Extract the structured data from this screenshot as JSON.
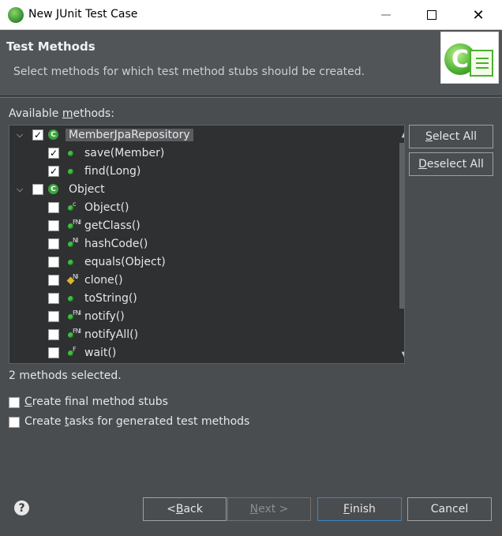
{
  "window": {
    "title": "New JUnit Test Case"
  },
  "header": {
    "title": "Test Methods",
    "description": "Select methods for which test method stubs should be created."
  },
  "available_label_pre": "Available ",
  "available_label_u": "m",
  "available_label_post": "ethods:",
  "tree": {
    "nodes": [
      {
        "label": "MemberJpaRepository",
        "level": 0,
        "checked": true,
        "icon": "class-icon",
        "expanded": true,
        "selected": true
      },
      {
        "label": "save(Member)",
        "level": 1,
        "checked": true,
        "icon": "public-method-icon"
      },
      {
        "label": "find(Long)",
        "level": 1,
        "checked": true,
        "icon": "public-method-icon"
      },
      {
        "label": "Object",
        "level": 0,
        "checked": false,
        "icon": "class-icon",
        "expanded": true
      },
      {
        "label": "Object()",
        "level": 1,
        "checked": false,
        "icon": "constructor-icon"
      },
      {
        "label": "getClass()",
        "level": 1,
        "checked": false,
        "icon": "final-native-method-icon"
      },
      {
        "label": "hashCode()",
        "level": 1,
        "checked": false,
        "icon": "native-method-icon"
      },
      {
        "label": "equals(Object)",
        "level": 1,
        "checked": false,
        "icon": "public-method-icon"
      },
      {
        "label": "clone()",
        "level": 1,
        "checked": false,
        "icon": "protected-method-icon"
      },
      {
        "label": "toString()",
        "level": 1,
        "checked": false,
        "icon": "public-method-icon"
      },
      {
        "label": "notify()",
        "level": 1,
        "checked": false,
        "icon": "final-native-method-icon"
      },
      {
        "label": "notifyAll()",
        "level": 1,
        "checked": false,
        "icon": "final-native-method-icon"
      },
      {
        "label": "wait()",
        "level": 1,
        "checked": false,
        "icon": "final-method-icon"
      }
    ]
  },
  "buttons": {
    "select_all_u": "S",
    "select_all_rest": "elect All",
    "deselect_all_u": "D",
    "deselect_all_rest": "eselect All",
    "back_pre": "< ",
    "back_u": "B",
    "back_rest": "ack",
    "next_u": "N",
    "next_rest": "ext >",
    "finish_u": "F",
    "finish_rest": "inish",
    "cancel": "Cancel"
  },
  "status": "2 methods selected.",
  "options": {
    "final_stubs_u": "C",
    "final_stubs_rest": "reate final method stubs",
    "tasks_pre": "Create ",
    "tasks_u": "t",
    "tasks_rest": "asks for generated test methods"
  },
  "help_icon": "?",
  "colors": {
    "accent": "#3b86c4",
    "background": "#4a4d50",
    "tree_background": "#2f3032"
  }
}
